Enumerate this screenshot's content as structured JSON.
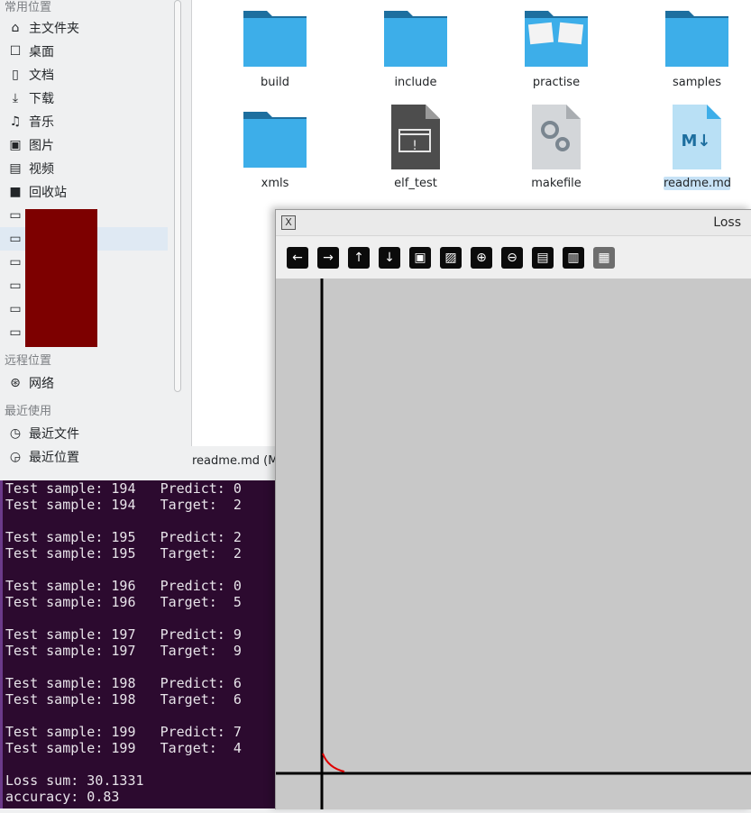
{
  "sidebar": {
    "places_header": "常用位置",
    "places": [
      {
        "label": "主文件夹",
        "icon": "home-icon"
      },
      {
        "label": "桌面",
        "icon": "desktop-icon"
      },
      {
        "label": "文档",
        "icon": "document-icon"
      },
      {
        "label": "下载",
        "icon": "download-icon"
      },
      {
        "label": "音乐",
        "icon": "music-icon"
      },
      {
        "label": "图片",
        "icon": "picture-icon"
      },
      {
        "label": "视频",
        "icon": "video-icon"
      },
      {
        "label": "回收站",
        "icon": "trash-icon"
      }
    ],
    "remote_header": "远程位置",
    "remote": [
      {
        "label": "网络",
        "icon": "network-icon"
      }
    ],
    "recent_header": "最近使用",
    "recent": [
      {
        "label": "最近文件",
        "icon": "recent-files-icon"
      },
      {
        "label": "最近位置",
        "icon": "recent-locations-icon"
      }
    ]
  },
  "files": [
    {
      "name": "build",
      "type": "folder"
    },
    {
      "name": "include",
      "type": "folder"
    },
    {
      "name": "practise",
      "type": "folder-open"
    },
    {
      "name": "samples",
      "type": "folder"
    },
    {
      "name": "xmls",
      "type": "folder"
    },
    {
      "name": "elf_test",
      "type": "executable"
    },
    {
      "name": "makefile",
      "type": "config"
    },
    {
      "name": "readme.md",
      "type": "markdown",
      "selected": true
    }
  ],
  "statusbar": {
    "text": "readme.md (Ma"
  },
  "terminal": {
    "lines": [
      "Test sample: 194   Predict: 0",
      "Test sample: 194   Target:  2",
      "",
      "Test sample: 195   Predict: 2",
      "Test sample: 195   Target:  2",
      "",
      "Test sample: 196   Predict: 0",
      "Test sample: 196   Target:  5",
      "",
      "Test sample: 197   Predict: 9",
      "Test sample: 197   Target:  9",
      "",
      "Test sample: 198   Predict: 6",
      "Test sample: 198   Target:  6",
      "",
      "Test sample: 199   Predict: 7",
      "Test sample: 199   Target:  4",
      "",
      "Loss sum: 30.1331",
      "accuracy: 0.83"
    ]
  },
  "loss_window": {
    "title": "Loss",
    "toolbar": [
      {
        "icon": "arrow-left-icon",
        "glyph": "←"
      },
      {
        "icon": "arrow-right-icon",
        "glyph": "→"
      },
      {
        "icon": "arrow-up-icon",
        "glyph": "↑"
      },
      {
        "icon": "arrow-down-icon",
        "glyph": "↓"
      },
      {
        "icon": "image-icon",
        "glyph": "▣"
      },
      {
        "icon": "image-edit-icon",
        "glyph": "▨"
      },
      {
        "icon": "zoom-in-icon",
        "glyph": "⊕"
      },
      {
        "icon": "zoom-out-icon",
        "glyph": "⊖"
      },
      {
        "icon": "save-icon",
        "glyph": "▤"
      },
      {
        "icon": "clipboard-icon",
        "glyph": "▥"
      },
      {
        "icon": "floppy-icon",
        "glyph": "▦",
        "disabled": true
      }
    ],
    "colors": {
      "axis": "#000000",
      "curve": "#e00000",
      "background": "#c8c8c8"
    }
  }
}
